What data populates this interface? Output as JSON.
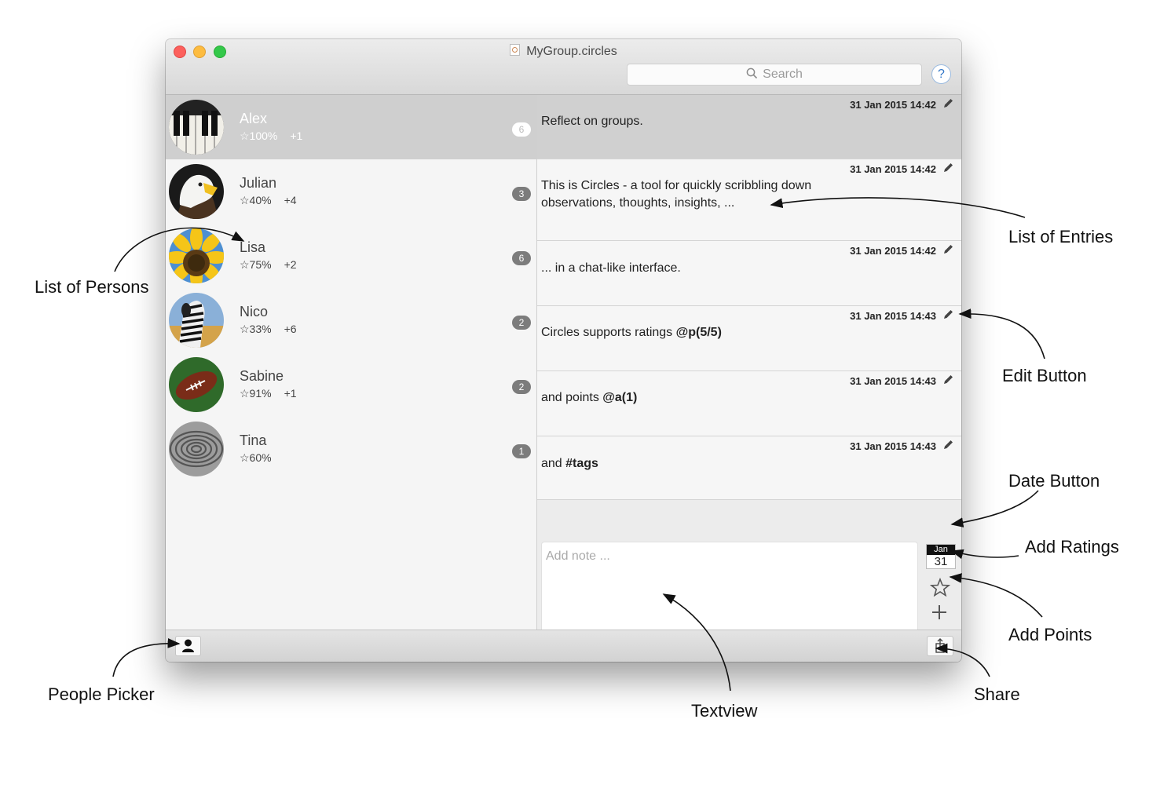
{
  "window": {
    "title": "MyGroup.circles",
    "search_placeholder": "Search",
    "help_label": "?"
  },
  "persons": [
    {
      "name": "Alex",
      "rating": "☆100%",
      "points": "+1",
      "count": "6",
      "selected": true
    },
    {
      "name": "Julian",
      "rating": "☆40%",
      "points": "+4",
      "count": "3"
    },
    {
      "name": "Lisa",
      "rating": "☆75%",
      "points": "+2",
      "count": "6"
    },
    {
      "name": "Nico",
      "rating": "☆33%",
      "points": "+6",
      "count": "2"
    },
    {
      "name": "Sabine",
      "rating": "☆91%",
      "points": "+1",
      "count": "2"
    },
    {
      "name": "Tina",
      "rating": "☆60%",
      "points": "",
      "count": "1"
    }
  ],
  "entries": [
    {
      "date": "31 Jan 2015 14:42",
      "text": "Reflect on groups."
    },
    {
      "date": "31 Jan 2015 14:42",
      "text": "This is Circles - a tool for quickly scribbling down observations, thoughts, insights, ..."
    },
    {
      "date": "31 Jan 2015 14:42",
      "text": "... in a chat-like interface."
    },
    {
      "date": "31 Jan 2015 14:43",
      "text_plain": "Circles supports ratings ",
      "text_bold": "@p(5/5)"
    },
    {
      "date": "31 Jan 2015 14:43",
      "text_plain": "and points ",
      "text_bold": "@a(1)"
    },
    {
      "date": "31 Jan 2015 14:43",
      "text_plain": "and ",
      "text_bold": "#tags"
    }
  ],
  "composer": {
    "placeholder": "Add note ...",
    "date_month": "Jan",
    "date_day": "31"
  },
  "annotations": {
    "list_of_persons": "List of Persons",
    "list_of_entries": "List of Entries",
    "edit_button": "Edit Button",
    "date_button": "Date Button",
    "add_ratings": "Add Ratings",
    "add_points": "Add Points",
    "people_picker": "People Picker",
    "textview": "Textview",
    "share": "Share"
  }
}
